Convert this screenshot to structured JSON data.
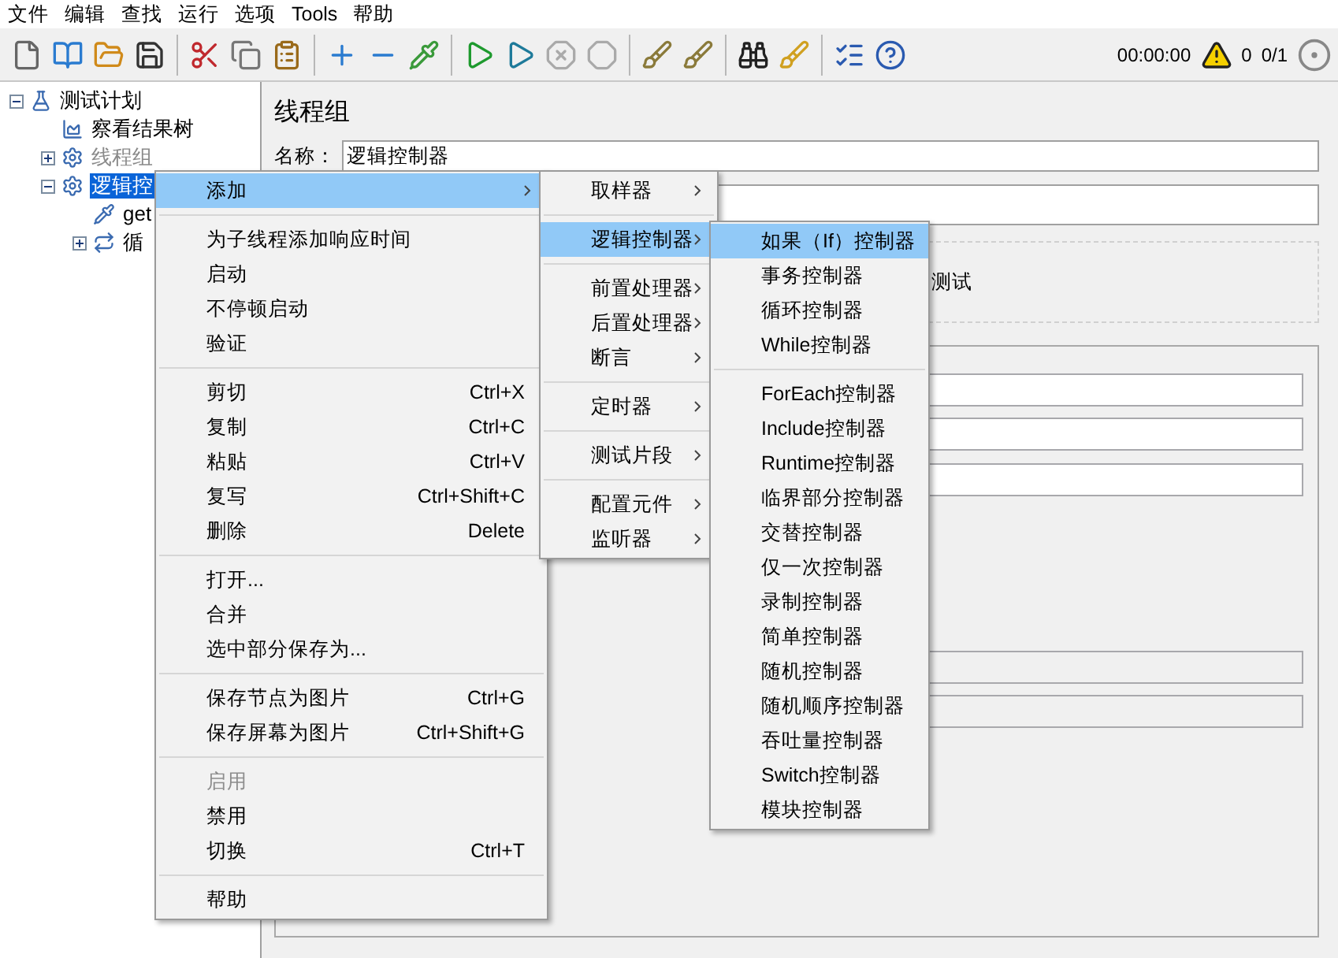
{
  "menubar": [
    {
      "label": "文件"
    },
    {
      "label": "编辑"
    },
    {
      "label": "查找"
    },
    {
      "label": "运行"
    },
    {
      "label": "选项"
    },
    {
      "label": "Tools"
    },
    {
      "label": "帮助"
    }
  ],
  "toolbar": {
    "timer": "00:00:00",
    "warnings": "0",
    "threads": "0/1"
  },
  "tree": [
    {
      "label": "测试计划",
      "kind": "plan",
      "expanded": true,
      "selected": false,
      "disabled": false,
      "children": [
        {
          "label": "察看结果树",
          "kind": "listener",
          "selected": false,
          "disabled": false
        },
        {
          "label": "线程组",
          "kind": "group",
          "expanded": false,
          "selected": false,
          "disabled": true
        },
        {
          "label": "逻辑控",
          "kind": "group",
          "expanded": true,
          "selected": true,
          "disabled": false,
          "children": [
            {
              "label": "get",
              "kind": "sampler",
              "selected": false,
              "disabled": false
            },
            {
              "label": "循",
              "kind": "loop",
              "expanded": false,
              "selected": false,
              "disabled": false
            }
          ]
        }
      ]
    }
  ],
  "panel": {
    "title": "线程组",
    "name_label": "名称：",
    "name_value": "逻辑控制器",
    "group_text": "测试"
  },
  "context_menu": [
    {
      "kind": "item",
      "label": "添加",
      "submenu": true,
      "selected": true,
      "disabled": false
    },
    {
      "kind": "separator"
    },
    {
      "kind": "item",
      "label": "为子线程添加响应时间",
      "submenu": false,
      "selected": false,
      "disabled": false
    },
    {
      "kind": "item",
      "label": "启动",
      "submenu": false,
      "selected": false,
      "disabled": false
    },
    {
      "kind": "item",
      "label": "不停顿启动",
      "submenu": false,
      "selected": false,
      "disabled": false
    },
    {
      "kind": "item",
      "label": "验证",
      "submenu": false,
      "selected": false,
      "disabled": false
    },
    {
      "kind": "separator"
    },
    {
      "kind": "item",
      "label": "剪切",
      "shortcut": "Ctrl+X",
      "submenu": false,
      "selected": false,
      "disabled": false
    },
    {
      "kind": "item",
      "label": "复制",
      "shortcut": "Ctrl+C",
      "submenu": false,
      "selected": false,
      "disabled": false
    },
    {
      "kind": "item",
      "label": "粘贴",
      "shortcut": "Ctrl+V",
      "submenu": false,
      "selected": false,
      "disabled": false
    },
    {
      "kind": "item",
      "label": "复写",
      "shortcut": "Ctrl+Shift+C",
      "submenu": false,
      "selected": false,
      "disabled": false
    },
    {
      "kind": "item",
      "label": "删除",
      "shortcut": "Delete",
      "submenu": false,
      "selected": false,
      "disabled": false
    },
    {
      "kind": "separator"
    },
    {
      "kind": "item",
      "label": "打开...",
      "submenu": false,
      "selected": false,
      "disabled": false
    },
    {
      "kind": "item",
      "label": "合并",
      "submenu": false,
      "selected": false,
      "disabled": false
    },
    {
      "kind": "item",
      "label": "选中部分保存为...",
      "submenu": false,
      "selected": false,
      "disabled": false
    },
    {
      "kind": "separator"
    },
    {
      "kind": "item",
      "label": "保存节点为图片",
      "shortcut": "Ctrl+G",
      "submenu": false,
      "selected": false,
      "disabled": false
    },
    {
      "kind": "item",
      "label": "保存屏幕为图片",
      "shortcut": "Ctrl+Shift+G",
      "submenu": false,
      "selected": false,
      "disabled": false
    },
    {
      "kind": "separator"
    },
    {
      "kind": "item",
      "label": "启用",
      "submenu": false,
      "selected": false,
      "disabled": true
    },
    {
      "kind": "item",
      "label": "禁用",
      "submenu": false,
      "selected": false,
      "disabled": false
    },
    {
      "kind": "item",
      "label": "切换",
      "shortcut": "Ctrl+T",
      "submenu": false,
      "selected": false,
      "disabled": false
    },
    {
      "kind": "separator"
    },
    {
      "kind": "item",
      "label": "帮助",
      "submenu": false,
      "selected": false,
      "disabled": false
    }
  ],
  "add_submenu": [
    {
      "kind": "item",
      "label": "取样器",
      "submenu": true,
      "selected": false,
      "disabled": false
    },
    {
      "kind": "separator"
    },
    {
      "kind": "item",
      "label": "逻辑控制器",
      "submenu": true,
      "selected": true,
      "disabled": false
    },
    {
      "kind": "separator"
    },
    {
      "kind": "item",
      "label": "前置处理器",
      "submenu": true,
      "selected": false,
      "disabled": false
    },
    {
      "kind": "item",
      "label": "后置处理器",
      "submenu": true,
      "selected": false,
      "disabled": false
    },
    {
      "kind": "item",
      "label": "断言",
      "submenu": true,
      "selected": false,
      "disabled": false
    },
    {
      "kind": "separator"
    },
    {
      "kind": "item",
      "label": "定时器",
      "submenu": true,
      "selected": false,
      "disabled": false
    },
    {
      "kind": "separator"
    },
    {
      "kind": "item",
      "label": "测试片段",
      "submenu": true,
      "selected": false,
      "disabled": false
    },
    {
      "kind": "separator"
    },
    {
      "kind": "item",
      "label": "配置元件",
      "submenu": true,
      "selected": false,
      "disabled": false
    },
    {
      "kind": "item",
      "label": "监听器",
      "submenu": true,
      "selected": false,
      "disabled": false
    }
  ],
  "controller_submenu": [
    {
      "kind": "item",
      "label": "如果（If）控制器",
      "submenu": false,
      "selected": true,
      "disabled": false
    },
    {
      "kind": "item",
      "label": "事务控制器",
      "submenu": false,
      "selected": false,
      "disabled": false
    },
    {
      "kind": "item",
      "label": "循环控制器",
      "submenu": false,
      "selected": false,
      "disabled": false
    },
    {
      "kind": "item",
      "label": "While控制器",
      "submenu": false,
      "selected": false,
      "disabled": false
    },
    {
      "kind": "separator"
    },
    {
      "kind": "item",
      "label": "ForEach控制器",
      "submenu": false,
      "selected": false,
      "disabled": false
    },
    {
      "kind": "item",
      "label": "Include控制器",
      "submenu": false,
      "selected": false,
      "disabled": false
    },
    {
      "kind": "item",
      "label": "Runtime控制器",
      "submenu": false,
      "selected": false,
      "disabled": false
    },
    {
      "kind": "item",
      "label": "临界部分控制器",
      "submenu": false,
      "selected": false,
      "disabled": false
    },
    {
      "kind": "item",
      "label": "交替控制器",
      "submenu": false,
      "selected": false,
      "disabled": false
    },
    {
      "kind": "item",
      "label": "仅一次控制器",
      "submenu": false,
      "selected": false,
      "disabled": false
    },
    {
      "kind": "item",
      "label": "录制控制器",
      "submenu": false,
      "selected": false,
      "disabled": false
    },
    {
      "kind": "item",
      "label": "简单控制器",
      "submenu": false,
      "selected": false,
      "disabled": false
    },
    {
      "kind": "item",
      "label": "随机控制器",
      "submenu": false,
      "selected": false,
      "disabled": false
    },
    {
      "kind": "item",
      "label": "随机顺序控制器",
      "submenu": false,
      "selected": false,
      "disabled": false
    },
    {
      "kind": "item",
      "label": "吞吐量控制器",
      "submenu": false,
      "selected": false,
      "disabled": false
    },
    {
      "kind": "item",
      "label": "Switch控制器",
      "submenu": false,
      "selected": false,
      "disabled": false
    },
    {
      "kind": "item",
      "label": "模块控制器",
      "submenu": false,
      "selected": false,
      "disabled": false
    }
  ]
}
